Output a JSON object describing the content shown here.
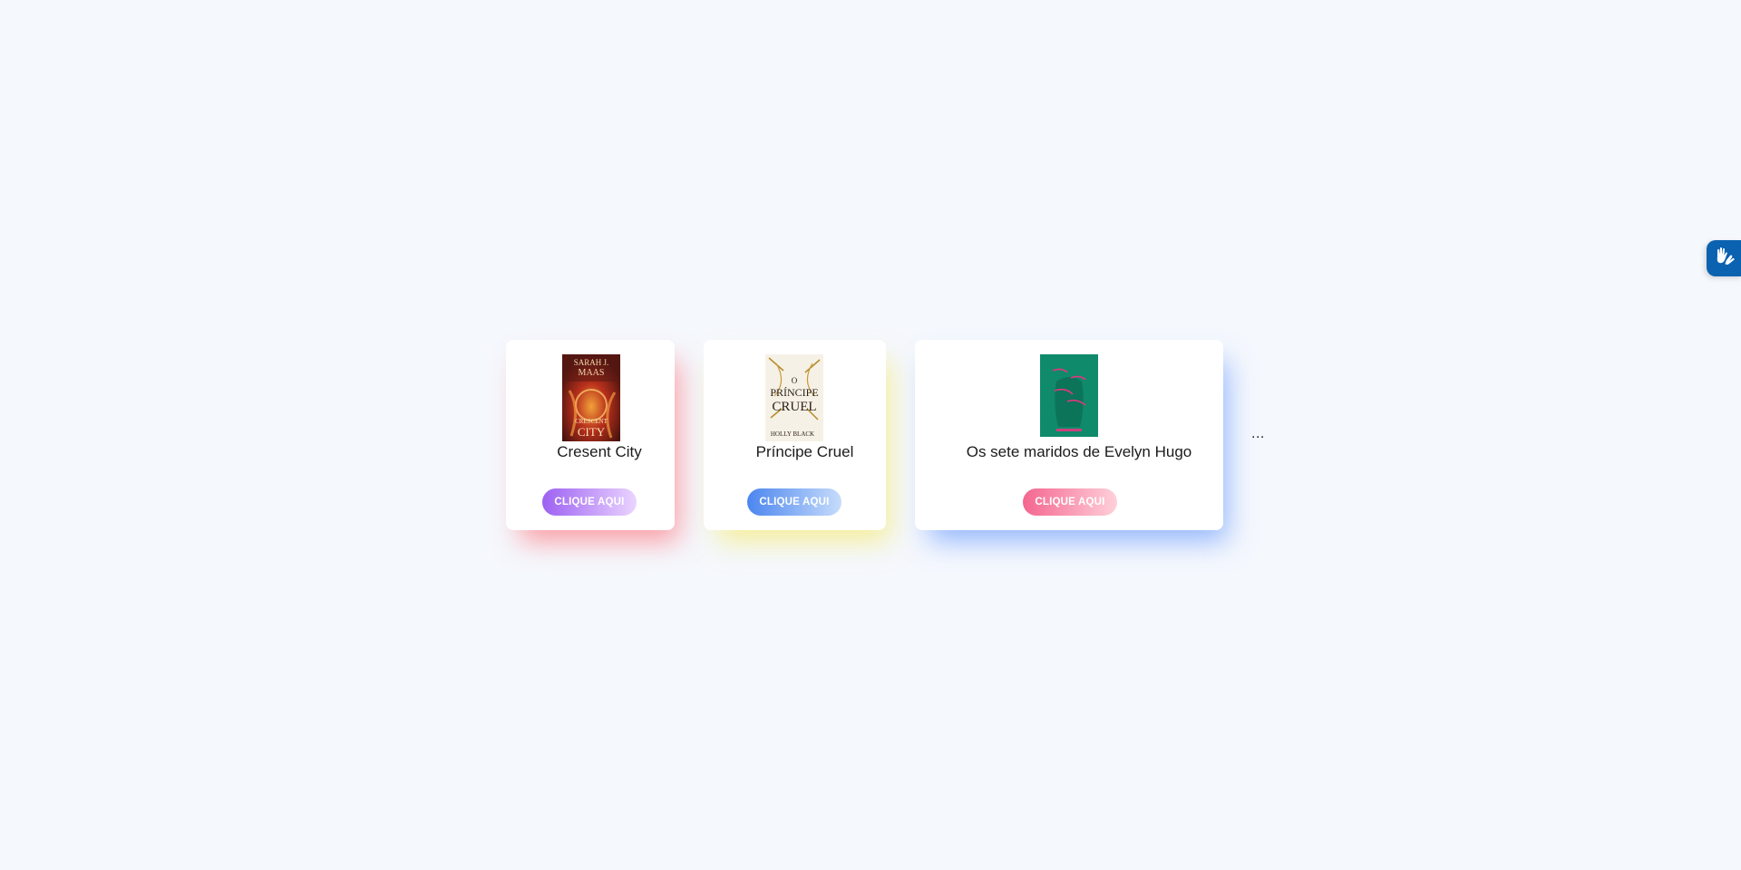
{
  "books": [
    {
      "title": "Cresent City",
      "button_label": "CLIQUE AQUI",
      "cover_lines": [
        "SARAH J.",
        "MAAS",
        "CRESCENT",
        "CITY"
      ],
      "accent": "#ff5a64"
    },
    {
      "title": "Príncipe Cruel",
      "button_label": "CLIQUE AQUI",
      "cover_lines": [
        "O",
        "PRÍNCIPE",
        "CRUEL",
        "HOLLY BLACK"
      ],
      "accent": "#f5e646"
    },
    {
      "title": "Os sete maridos de Evelyn Hugo",
      "button_label": "CLIQUE AQUI",
      "accent": "#4682ff"
    }
  ],
  "more_indicator": "...",
  "accessibility_widget": {
    "icon": "sign-language-hands-icon"
  }
}
